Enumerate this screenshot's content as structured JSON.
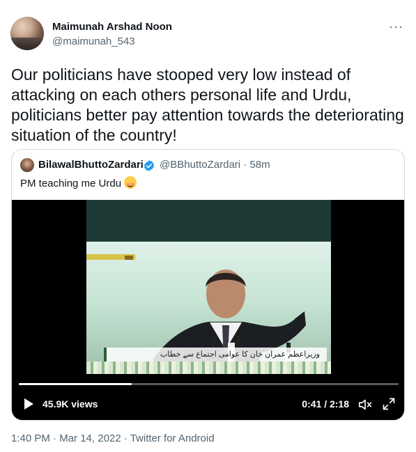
{
  "author": {
    "name": "Maimunah Arshad Noon",
    "handle": "@maimunah_543"
  },
  "more_label": "···",
  "tweet_text": "Our politicians have stooped very low instead of attacking on each others personal life and Urdu, politicians better pay attention towards the deteriorating situation of the country!",
  "quote": {
    "name": "BilawalBhuttoZardari",
    "handle": "@BBhuttoZardari",
    "separator": "·",
    "time": "58m",
    "text": "PM teaching me Urdu",
    "verified_color": "#1d9bf0"
  },
  "video": {
    "banner_text": "وزیراعظم عمران خان کا عوامی اجتماع سے خطاب",
    "views": "45.9K views",
    "timecode": "0:41 / 2:18",
    "progress_fraction": 0.297
  },
  "footer": {
    "time": "1:40 PM",
    "separator": "·",
    "date": "Mar 14, 2022",
    "separator2": "·",
    "source": "Twitter for Android"
  }
}
